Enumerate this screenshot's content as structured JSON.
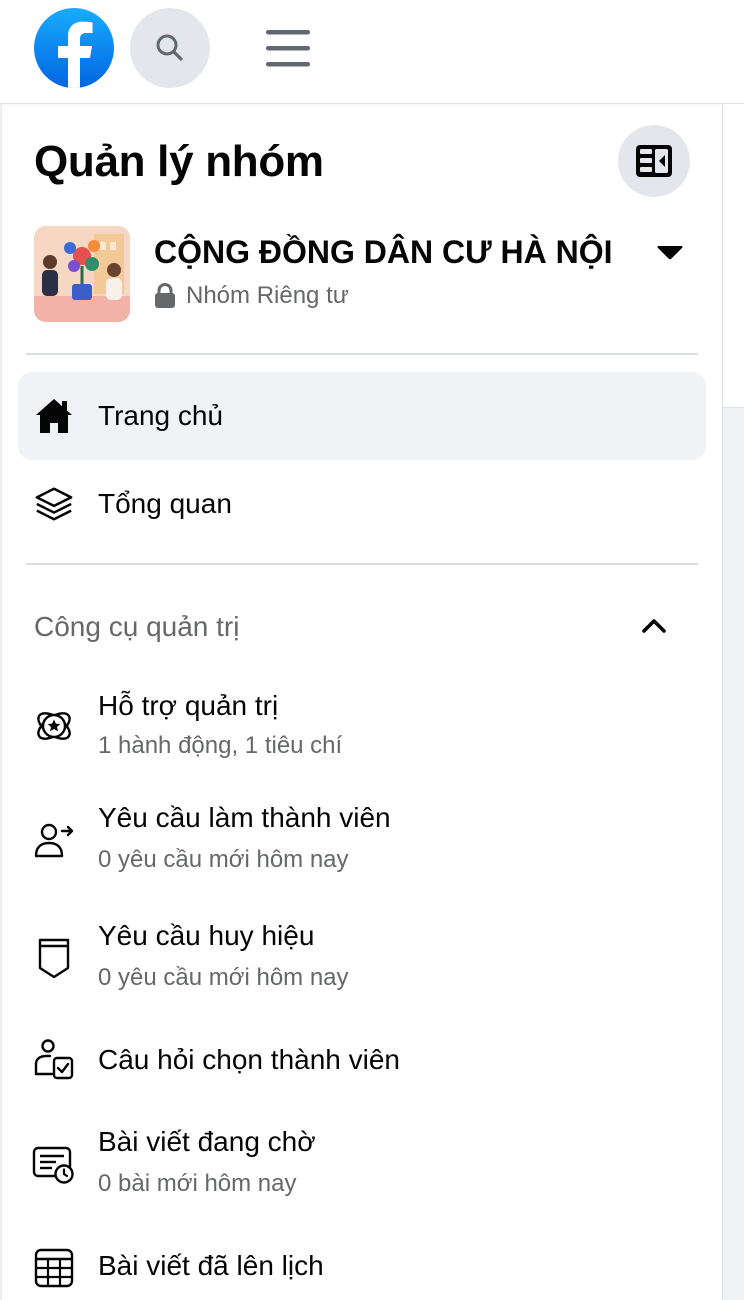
{
  "topbar": {
    "logo_icon": "facebook-logo",
    "search_icon": "search-icon",
    "menu_icon": "hamburger-menu-icon"
  },
  "panel": {
    "title": "Quản lý nhóm",
    "collapse_icon": "sidebar-collapse-icon"
  },
  "group": {
    "name": "CỘNG ĐỒNG DÂN CƯ HÀ NỘI",
    "privacy": "Nhóm Riêng tư",
    "privacy_icon": "lock-icon",
    "dropdown_icon": "caret-down-icon"
  },
  "nav": {
    "items": [
      {
        "label": "Trang chủ",
        "icon": "home-icon",
        "active": true
      },
      {
        "label": "Tổng quan",
        "icon": "layers-icon",
        "active": false
      }
    ]
  },
  "admin_tools": {
    "section_title": "Công cụ quản trị",
    "chevron_icon": "chevron-up-icon",
    "items": [
      {
        "title": "Hỗ trợ quản trị",
        "subtitle": "1 hành động, 1 tiêu chí",
        "icon": "admin-assist-icon"
      },
      {
        "title": "Yêu cầu làm thành viên",
        "subtitle": "0 yêu cầu mới hôm nay",
        "icon": "member-request-icon"
      },
      {
        "title": "Yêu cầu huy hiệu",
        "subtitle": "0 yêu cầu mới hôm nay",
        "icon": "badge-icon"
      },
      {
        "title": "Câu hỏi chọn thành viên",
        "subtitle": "",
        "icon": "membership-questions-icon"
      },
      {
        "title": "Bài viết đang chờ",
        "subtitle": "0 bài mới hôm nay",
        "icon": "pending-posts-icon"
      },
      {
        "title": "Bài viết đã lên lịch",
        "subtitle": "",
        "icon": "scheduled-posts-icon"
      }
    ]
  },
  "colors": {
    "brand": "#0866ff",
    "secondary_text": "#65676b",
    "active_bg": "#f0f2f5",
    "button_bg": "#e4e6eb"
  }
}
